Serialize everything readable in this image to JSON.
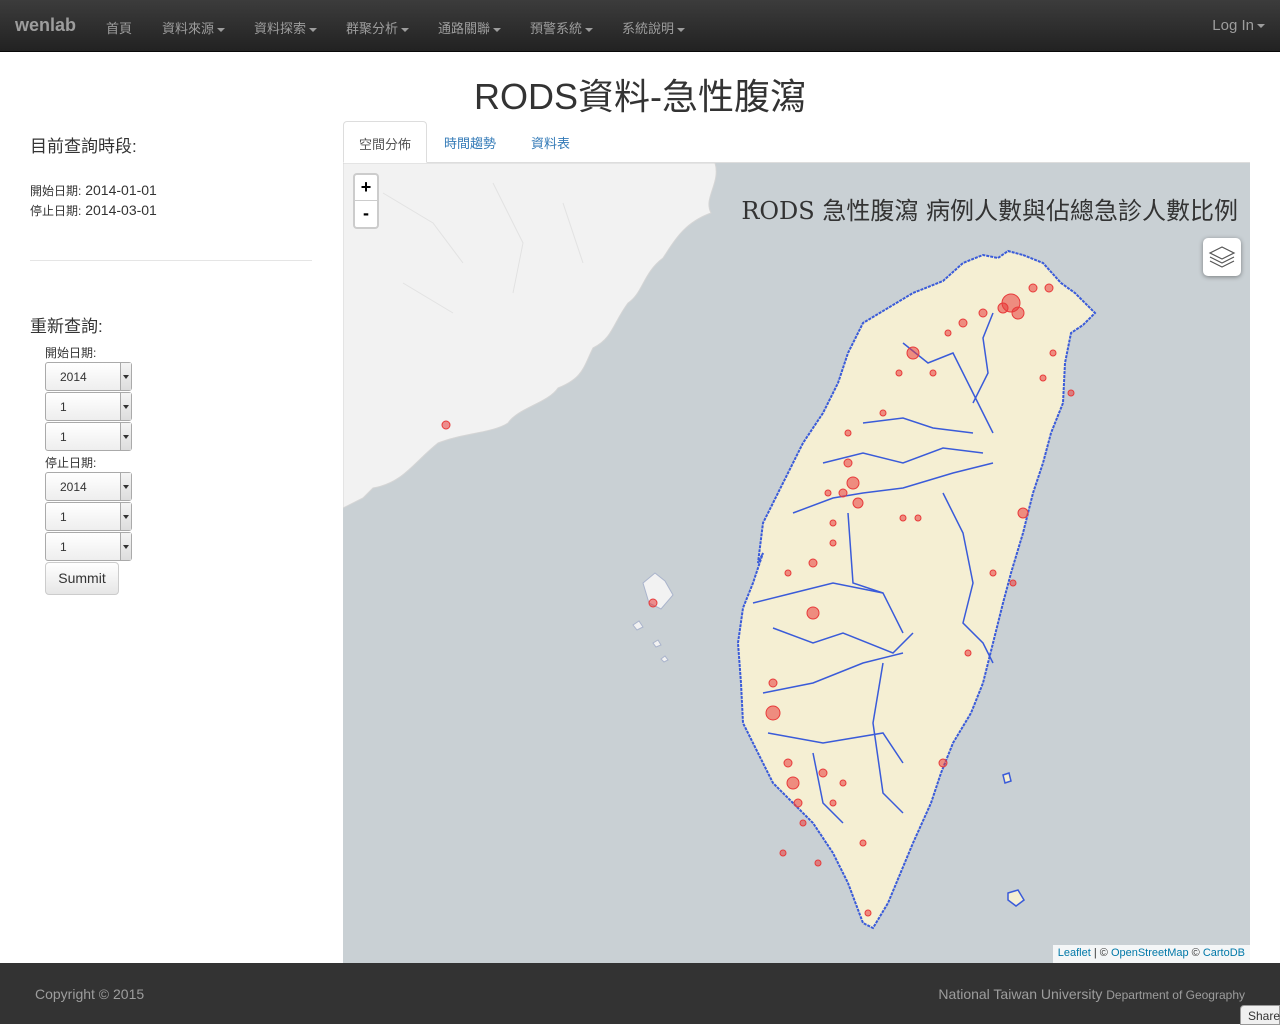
{
  "navbar": {
    "brand": "wenlab",
    "items": [
      {
        "label": "首頁",
        "dropdown": false
      },
      {
        "label": "資料來源",
        "dropdown": true
      },
      {
        "label": "資料探索",
        "dropdown": true
      },
      {
        "label": "群聚分析",
        "dropdown": true
      },
      {
        "label": "通路關聯",
        "dropdown": true
      },
      {
        "label": "預警系統",
        "dropdown": true
      },
      {
        "label": "系統說明",
        "dropdown": true
      }
    ],
    "login": "Log In"
  },
  "page_title": "RODS資料-急性腹瀉",
  "sidebar": {
    "current_heading": "目前查詢時段:",
    "start_label": "開始日期:",
    "start_value": "2014-01-01",
    "end_label": "停止日期:",
    "end_value": "2014-03-01",
    "requery_heading": "重新查詢:",
    "form": {
      "start_label": "開始日期:",
      "start_year": "2014",
      "start_month": "1",
      "start_day": "1",
      "end_label": "停止日期:",
      "end_year": "2014",
      "end_month": "1",
      "end_day": "1",
      "submit": "Summit"
    }
  },
  "tabs": [
    {
      "label": "空間分佈",
      "active": true
    },
    {
      "label": "時間趨勢",
      "active": false
    },
    {
      "label": "資料表",
      "active": false
    }
  ],
  "map": {
    "title": "RODS 急性腹瀉 病例人數與佔總急診人數比例",
    "zoom_in": "+",
    "zoom_out": "-",
    "attribution": {
      "leaflet": "Leaflet",
      "sep1": " | © ",
      "osm": "OpenStreetMap",
      "sep2": " © ",
      "carto": "CartoDB"
    },
    "colors": {
      "land": "#f5efd3",
      "sea": "#c9d0d4",
      "boundary": "#3a5bd9",
      "point": "#e83a3a"
    }
  },
  "footer": {
    "copyright": "Copyright © 2015",
    "university": "National Taiwan University",
    "department": "Department of Geography",
    "share": "Share"
  }
}
